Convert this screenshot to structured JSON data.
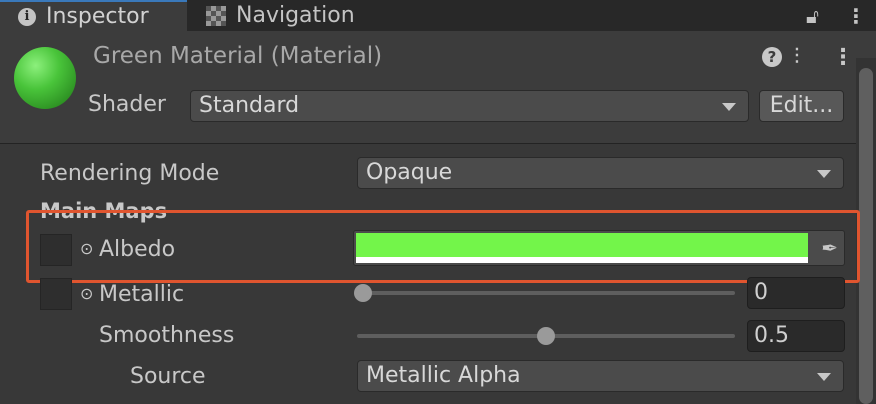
{
  "tabs": {
    "inspector": "Inspector",
    "navigation": "Navigation"
  },
  "material": {
    "title": "Green Material (Material)",
    "shader_label": "Shader",
    "shader_value": "Standard",
    "edit_label": "Edit..."
  },
  "properties": {
    "rendering_mode_label": "Rendering Mode",
    "rendering_mode_value": "Opaque",
    "main_maps_label": "Main Maps",
    "albedo_label": "Albedo",
    "albedo_color": "#73f54a",
    "metallic_label": "Metallic",
    "metallic_value": "0",
    "smoothness_label": "Smoothness",
    "smoothness_value": "0.5",
    "source_label": "Source",
    "source_value": "Metallic Alpha"
  },
  "colors": {
    "highlight_border": "#e0552f",
    "material_sphere": "#49c43a"
  }
}
